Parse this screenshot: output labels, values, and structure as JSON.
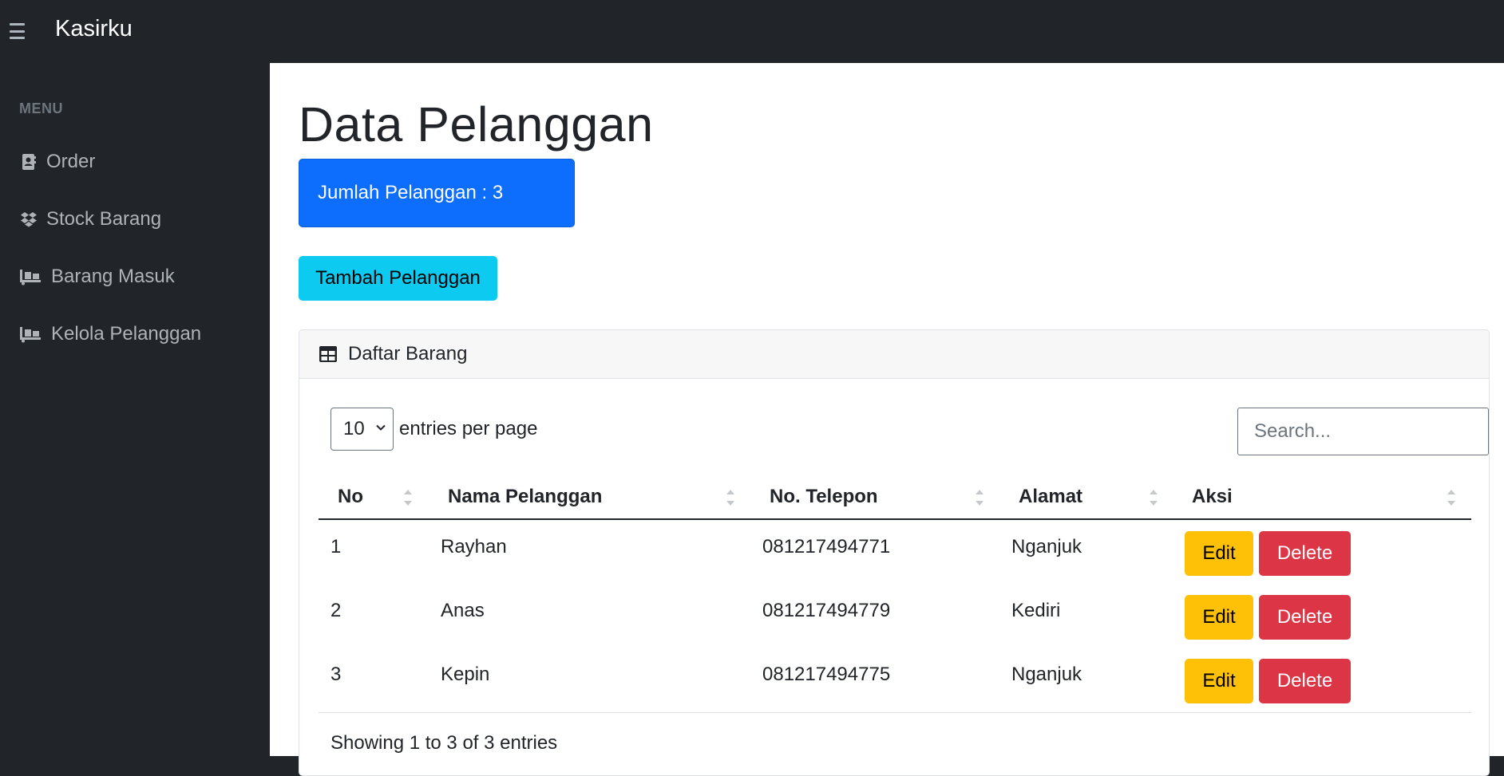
{
  "app": {
    "title": "Kasirku"
  },
  "sidebar": {
    "heading": "MENU",
    "items": [
      {
        "label": "Order",
        "icon": "address-book-icon"
      },
      {
        "label": "Stock Barang",
        "icon": "dropbox-icon"
      },
      {
        "label": "Barang Masuk",
        "icon": "truck-loading-icon"
      },
      {
        "label": "Kelola Pelanggan",
        "icon": "truck-loading-icon"
      }
    ]
  },
  "main": {
    "title": "Data Pelanggan",
    "count_label": "Jumlah Pelanggan : 3",
    "add_button": "Tambah Pelanggan",
    "card_title": "Daftar Barang",
    "per_page_value": "10",
    "per_page_label": "entries per page",
    "search_placeholder": "Search...",
    "columns": [
      "No",
      "Nama Pelanggan",
      "No. Telepon",
      "Alamat",
      "Aksi"
    ],
    "rows": [
      {
        "no": "1",
        "nama": "Rayhan",
        "telepon": "081217494771",
        "alamat": "Nganjuk",
        "edit": "Edit",
        "delete": "Delete"
      },
      {
        "no": "2",
        "nama": "Anas",
        "telepon": "081217494779",
        "alamat": "Kediri",
        "edit": "Edit",
        "delete": "Delete"
      },
      {
        "no": "3",
        "nama": "Kepin",
        "telepon": "081217494775",
        "alamat": "Nganjuk",
        "edit": "Edit",
        "delete": "Delete"
      }
    ],
    "footer_info": "Showing 1 to 3 of 3 entries"
  },
  "colors": {
    "sidebar_bg": "#212529",
    "primary": "#0d6efd",
    "info": "#0dcaf0",
    "warning": "#ffc107",
    "danger": "#dc3545"
  }
}
